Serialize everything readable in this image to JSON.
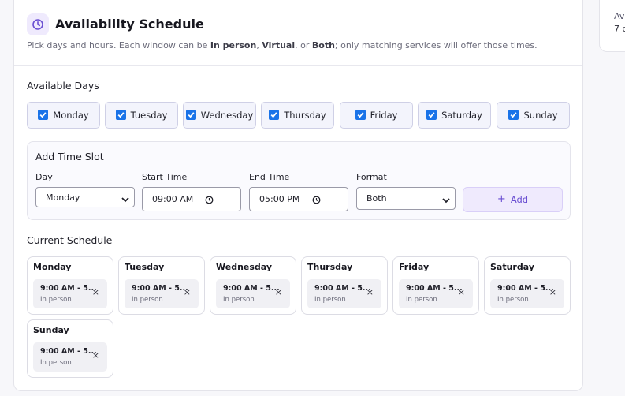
{
  "header": {
    "title": "Availability Schedule",
    "subtitle_parts": [
      "Pick days and hours. Each window can be ",
      "In person",
      ", ",
      "Virtual",
      ", or ",
      "Both",
      "; only matching services will offer those times."
    ]
  },
  "side_panel": {
    "line1": "Av",
    "line2": "7 d"
  },
  "available_days": {
    "label": "Available Days",
    "days": [
      {
        "label": "Monday",
        "checked": true
      },
      {
        "label": "Tuesday",
        "checked": true
      },
      {
        "label": "Wednesday",
        "checked": true
      },
      {
        "label": "Thursday",
        "checked": true
      },
      {
        "label": "Friday",
        "checked": true
      },
      {
        "label": "Saturday",
        "checked": true
      },
      {
        "label": "Sunday",
        "checked": true
      }
    ]
  },
  "add_slot": {
    "title": "Add Time Slot",
    "day_label": "Day",
    "day_value": "Monday",
    "start_label": "Start Time",
    "start_value": "09:00 AM",
    "end_label": "End Time",
    "end_value": "05:00 PM",
    "format_label": "Format",
    "format_value": "Both",
    "add_button": "Add"
  },
  "current_schedule": {
    "label": "Current Schedule",
    "entries": [
      {
        "day": "Monday",
        "time": "9:00 AM - 5...",
        "mode": "In person"
      },
      {
        "day": "Tuesday",
        "time": "9:00 AM - 5...",
        "mode": "In person"
      },
      {
        "day": "Wednesday",
        "time": "9:00 AM - 5...",
        "mode": "In person"
      },
      {
        "day": "Thursday",
        "time": "9:00 AM - 5...",
        "mode": "In person"
      },
      {
        "day": "Friday",
        "time": "9:00 AM - 5...",
        "mode": "In person"
      },
      {
        "day": "Saturday",
        "time": "9:00 AM - 5...",
        "mode": "In person"
      },
      {
        "day": "Sunday",
        "time": "9:00 AM - 5...",
        "mode": "In person"
      }
    ],
    "remove_glyph": "×"
  },
  "colors": {
    "accent": "#6a4fd2",
    "accent_bg": "#efeafd",
    "checkbox": "#1a73e8"
  }
}
